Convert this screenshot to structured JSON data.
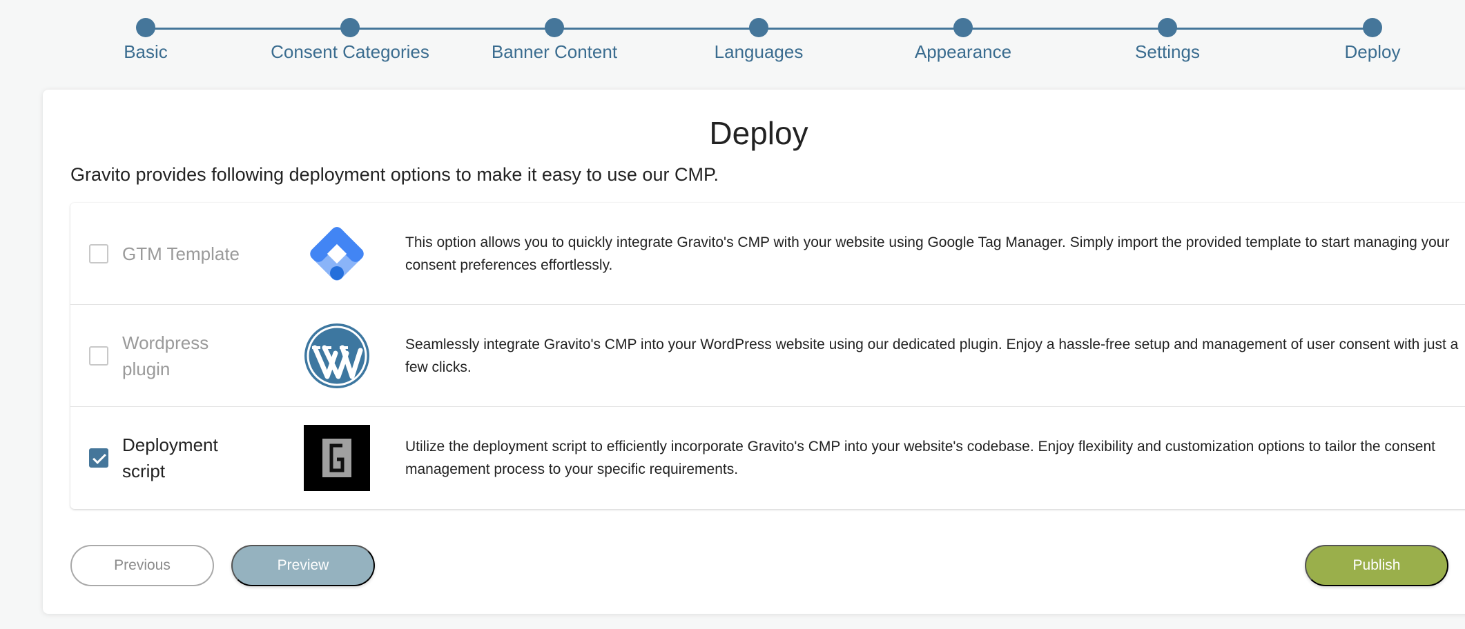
{
  "stepper": {
    "steps": [
      {
        "label": "Basic"
      },
      {
        "label": "Consent Categories"
      },
      {
        "label": "Banner Content"
      },
      {
        "label": "Languages"
      },
      {
        "label": "Appearance"
      },
      {
        "label": "Settings"
      },
      {
        "label": "Deploy"
      }
    ],
    "color": "#45769a"
  },
  "main": {
    "title": "Deploy",
    "intro": "Gravito provides following deployment options to make it easy to use our CMP.",
    "options": [
      {
        "label": "GTM Template",
        "checked": false,
        "icon": "google-tag-manager-logo",
        "description": "This option allows you to quickly integrate Gravito's CMP with your website using Google Tag Manager. Simply import the provided template to start managing your consent preferences effortlessly."
      },
      {
        "label": "Wordpress plugin",
        "checked": false,
        "icon": "wordpress-logo",
        "description": "Seamlessly integrate Gravito's CMP into your WordPress website using our dedicated plugin. Enjoy a hassle-free setup and management of user consent with just a few clicks."
      },
      {
        "label": "Deployment script",
        "checked": true,
        "icon": "gravito-logo",
        "description": "Utilize the deployment script to efficiently incorporate Gravito's CMP into your website's codebase. Enjoy flexibility and customization options to tailor the consent management process to your specific requirements."
      }
    ]
  },
  "footer": {
    "previous_label": "Previous",
    "preview_label": "Preview",
    "publish_label": "Publish"
  },
  "colors": {
    "accent": "#45769a",
    "publish": "#9aaf4b",
    "preview": "#95b2bf"
  }
}
